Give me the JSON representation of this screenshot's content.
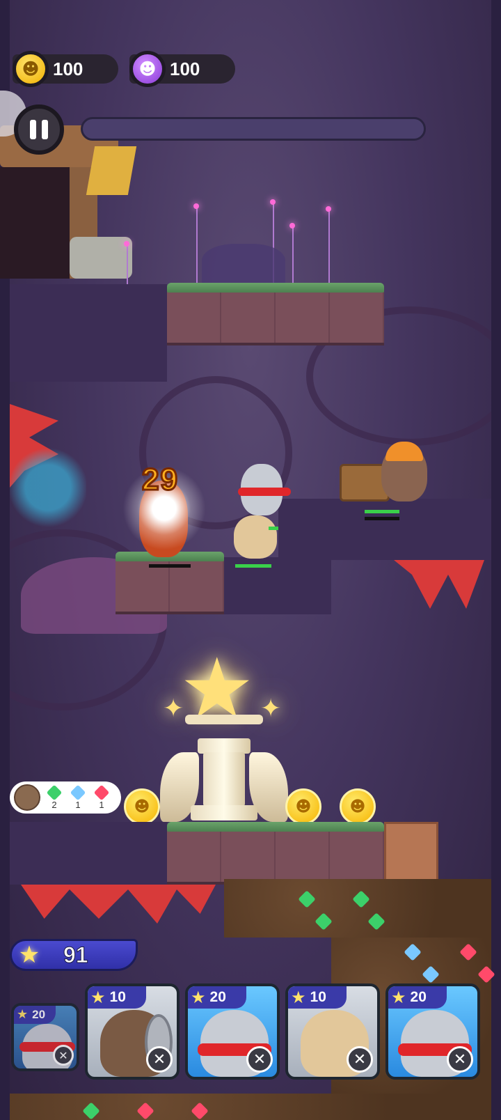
{
  "hud": {
    "gold": "100",
    "gems": "100",
    "pause_icon": "pause-icon",
    "level_progress": 0
  },
  "combat": {
    "damage_number": "29"
  },
  "reward_popup": {
    "gems": [
      {
        "color": "green",
        "count": "2"
      },
      {
        "color": "blue",
        "count": "1"
      },
      {
        "color": "red",
        "count": "1"
      }
    ]
  },
  "energy": {
    "value": "91"
  },
  "cards": [
    {
      "cost": "20",
      "type": "hamster-scarf",
      "state": "selected-small"
    },
    {
      "cost": "10",
      "type": "hamster-shield"
    },
    {
      "cost": "20",
      "type": "hamster-scarf"
    },
    {
      "cost": "10",
      "type": "hamster-fork"
    },
    {
      "cost": "20",
      "type": "hamster-scarf"
    }
  ],
  "colors": {
    "gold": "#f6b400",
    "gem_purple": "#8a3ad8",
    "card_blue": "#2a8ae0",
    "card_gray": "#a8b0bc",
    "hp_green": "#3ad04a",
    "energy_blue": "#3030a8"
  }
}
